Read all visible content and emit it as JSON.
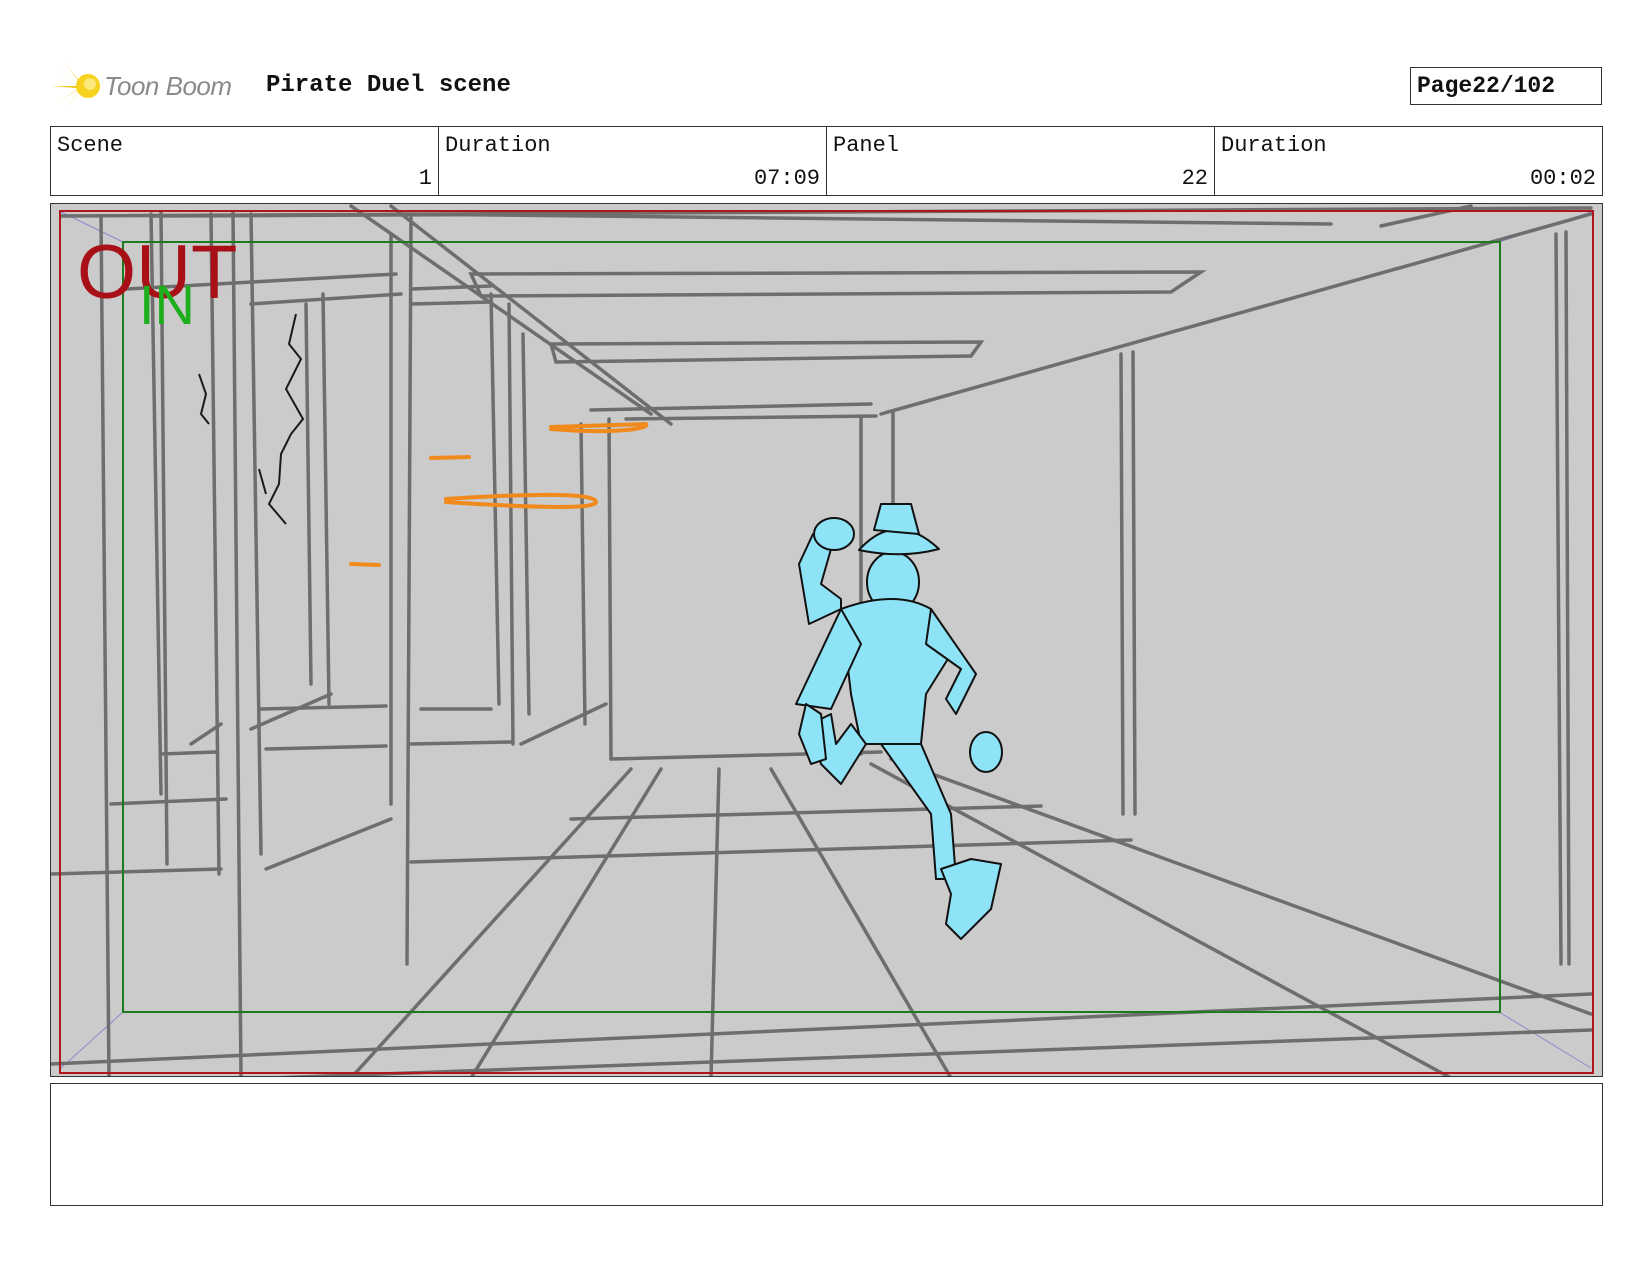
{
  "header": {
    "logo_text": "Toon Boom",
    "title": "Pirate Duel scene",
    "page_label": "Page",
    "page_value": "22/102"
  },
  "info": {
    "scene_label": "Scene",
    "scene_value": "1",
    "scene_duration_label": "Duration",
    "scene_duration_value": "07:09",
    "panel_label": "Panel",
    "panel_value": "22",
    "panel_duration_label": "Duration",
    "panel_duration_value": "00:02"
  },
  "panel": {
    "out_marker": "OUT",
    "in_marker": "IN",
    "colors": {
      "background": "#cbcbcb",
      "sketch_lines": "#6e6e6e",
      "out_frame": "#b0161e",
      "in_frame": "#1d7a1d",
      "character": "#8ee3f7",
      "effects": "#f08a1c"
    },
    "icons": [
      "toon-boom-logo-icon"
    ]
  },
  "notes": {
    "text": ""
  }
}
